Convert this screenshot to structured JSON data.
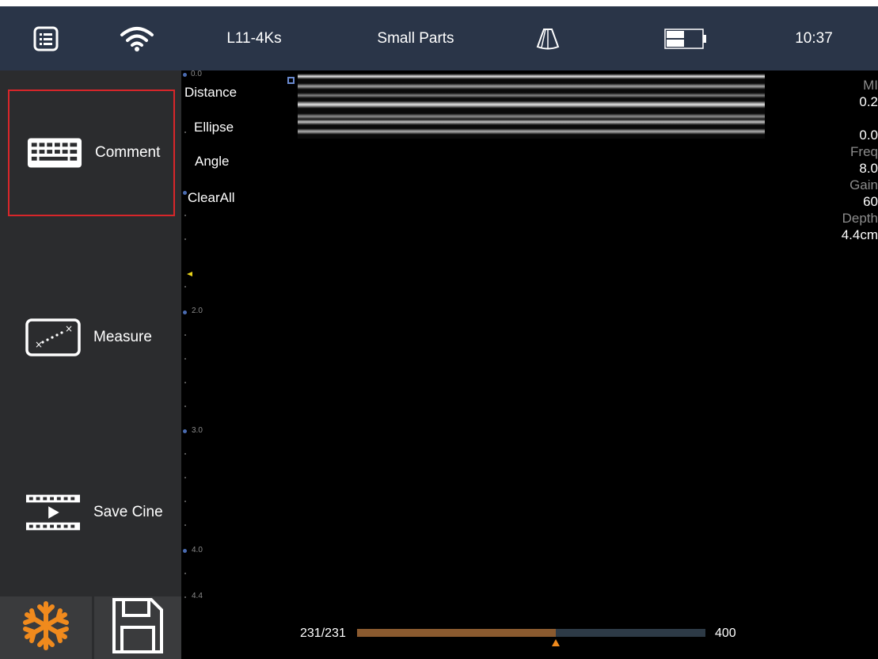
{
  "topbar": {
    "menu_icon": "list-menu-icon",
    "wifi_icon": "wifi-icon",
    "probe": "L11-4Ks",
    "preset": "Small Parts",
    "fan_icon": "sector-scan-icon",
    "battery_icon": "battery-icon",
    "time": "10:37"
  },
  "sidebar": {
    "comment_label": "Comment",
    "measure_label": "Measure",
    "save_cine_label": "Save Cine",
    "freeze_icon": "snowflake-icon",
    "save_icon": "floppy-disk-icon"
  },
  "measure_menu": {
    "items": [
      "Distance",
      "Ellipse",
      "Angle",
      "ClearAll"
    ]
  },
  "depth_scale": {
    "labels": [
      "0.0",
      "2.0",
      "3.0",
      "4.0",
      "4.4"
    ]
  },
  "params": {
    "mi_label": "MI",
    "mi_value": "0.2",
    "ti_value": "0.0",
    "freq_label": "Freq",
    "freq_value": "8.0",
    "gain_label": "Gain",
    "gain_value": "60",
    "depth_label": "Depth",
    "depth_value": "4.4cm"
  },
  "cine": {
    "frame_counter": "231/231",
    "total": "400",
    "progress": 0.57
  },
  "colors": {
    "topbar_bg": "#2a3548",
    "sidebar_bg": "#2b2c2e",
    "accent_orange": "#f08a1d",
    "selected_border": "#d8262a"
  }
}
